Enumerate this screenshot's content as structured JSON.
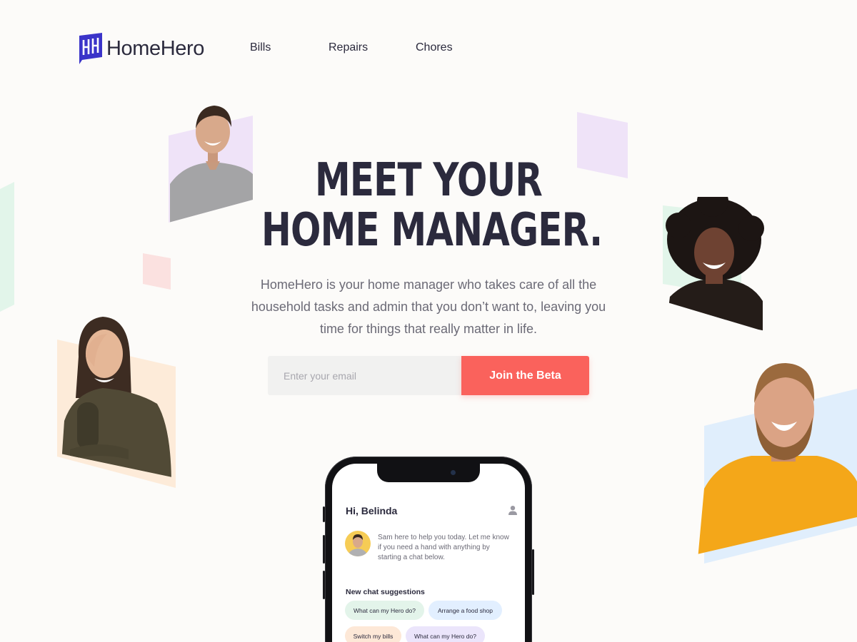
{
  "brand": {
    "logo_text": "HomeHero",
    "logo_icon": "hh-monogram-icon",
    "color": "#3b34c9"
  },
  "nav": {
    "items": [
      {
        "label": "Bills"
      },
      {
        "label": "Repairs"
      },
      {
        "label": "Chores"
      }
    ]
  },
  "hero": {
    "headline_line1": "MEET YOUR",
    "headline_line2": "HOME MANAGER.",
    "subtitle": "HomeHero is your home manager who takes care of all the household tasks and admin that you don’t want to, leaving you time for things that really matter in life.",
    "email_placeholder": "Enter your email",
    "email_value": "",
    "cta_label": "Join the Beta"
  },
  "phone": {
    "greeting": "Hi, Belinda",
    "profile_icon": "user-icon",
    "agent_message": "Sam here to help you today. Let me know if you need a hand with anything by starting a chat below.",
    "suggestions_title": "New chat suggestions",
    "suggestions": [
      {
        "label": "What can my Hero do?",
        "color": "#e3f4ea"
      },
      {
        "label": "Arrange a food shop",
        "color": "#e2efff"
      },
      {
        "label": "Switch my bills",
        "color": "#fde8d7"
      },
      {
        "label": "What can my Hero do?",
        "color": "#ebe5fb"
      }
    ]
  },
  "colors": {
    "background": "#fcfbf9",
    "text": "#2b2a3d",
    "muted_text": "#6b6a76",
    "accent": "#fa625c",
    "input_bg": "#f1f1f0",
    "decor_lavender": "#efe3f8",
    "decor_mint": "#e2f5ea",
    "decor_pink": "#fbe1e0",
    "decor_peach": "#fdebd9",
    "decor_blue": "#e0eefc"
  }
}
